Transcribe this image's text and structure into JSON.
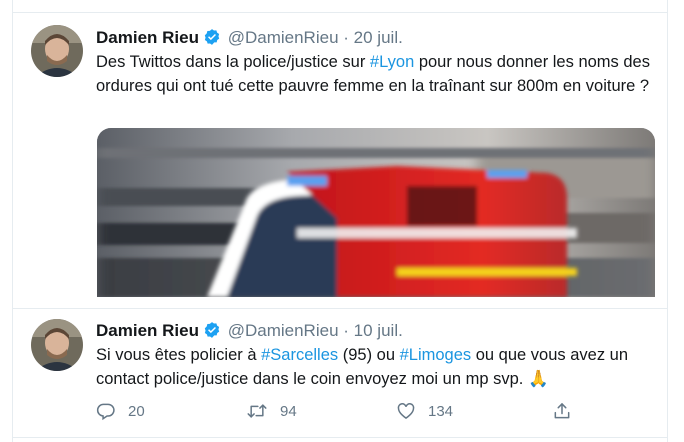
{
  "tweets": [
    {
      "display_name": "Damien Rieu",
      "handle": "@DamienRieu",
      "separator": "·",
      "date": "20 juil.",
      "text_segments": [
        {
          "text": "Des Twittos dans la police/justice sur ",
          "hashtag": false
        },
        {
          "text": "#Lyon",
          "hashtag": true
        },
        {
          "text": " pour nous donner les noms des ordures qui ont tué cette pauvre femme en la traînant sur 800m en voiture ?",
          "hashtag": false
        }
      ]
    },
    {
      "display_name": "Damien Rieu",
      "handle": "@DamienRieu",
      "separator": "·",
      "date": "10 juil.",
      "text_segments": [
        {
          "text": "Si vous êtes policier à ",
          "hashtag": false
        },
        {
          "text": "#Sarcelles",
          "hashtag": true
        },
        {
          "text": " (95) ou ",
          "hashtag": false
        },
        {
          "text": "#Limoges",
          "hashtag": true
        },
        {
          "text": " ou que vous avez un contact police/justice dans le coin envoyez moi un mp svp. ",
          "hashtag": false
        },
        {
          "text": "🙏",
          "hashtag": false,
          "emoji": true
        }
      ],
      "actions": {
        "reply_count": "20",
        "retweet_count": "94",
        "like_count": "134"
      }
    }
  ],
  "icons": {
    "verified": "verified-badge-icon",
    "reply": "reply-icon",
    "retweet": "retweet-icon",
    "like": "heart-icon",
    "share": "share-icon"
  },
  "colors": {
    "hashtag": "#1b95e0",
    "meta": "#657786",
    "verified": "#1da1f2",
    "border": "#e6ecf0"
  }
}
